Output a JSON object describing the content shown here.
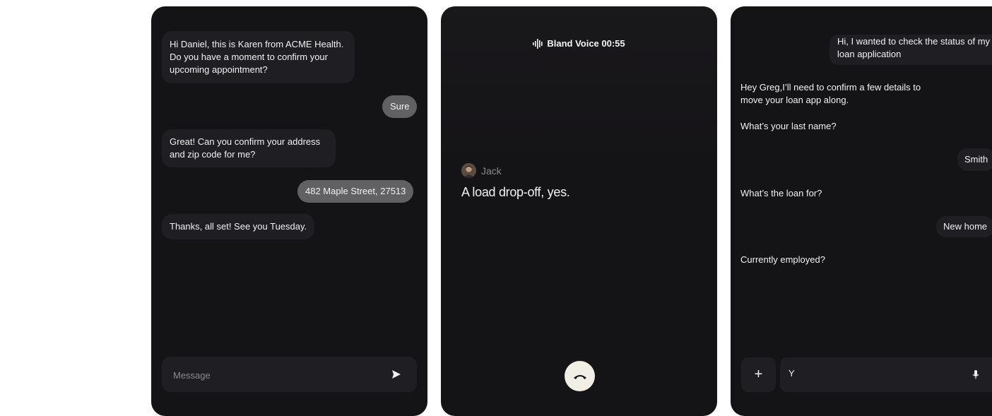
{
  "sms_chat": {
    "messages": [
      {
        "from": "agent",
        "text": "Hi Daniel, this is Karen from ACME Health. Do you have a moment to confirm your upcoming appointment?"
      },
      {
        "from": "user",
        "text": "Sure"
      },
      {
        "from": "agent",
        "text": "Great! Can you confirm your address and zip code for me?"
      },
      {
        "from": "user",
        "text": "482 Maple Street, 27513"
      },
      {
        "from": "agent",
        "text": "Thanks, all set! See you Tuesday."
      }
    ],
    "input_placeholder": "Message",
    "send_icon": "send-icon"
  },
  "voice_call": {
    "header_label": "Bland Voice 00:55",
    "speaker_name": "Jack",
    "transcript": "A load drop-off, yes.",
    "hangup_icon": "phone-hangup-icon"
  },
  "loan_chat": {
    "messages": [
      {
        "from": "user",
        "text": "Hi, I wanted to check the status of my loan application"
      },
      {
        "from": "agent",
        "text": "Hey Greg,I’ll need to confirm a few details to move your loan app along."
      },
      {
        "from": "agent",
        "text": "What’s your last name?"
      },
      {
        "from": "user",
        "text": "Smith"
      },
      {
        "from": "agent",
        "text": "What’s the loan for?"
      },
      {
        "from": "user",
        "text": "New home"
      },
      {
        "from": "agent",
        "text": "Currently employed?"
      }
    ],
    "plus_label": "+",
    "input_value": "Y",
    "mic_icon": "microphone-icon"
  },
  "colors": {
    "panel_bg": "#141316",
    "agent_bubble": "#1f1e22",
    "user_bubble": "#616063",
    "hangup_button": "#f1eee5"
  }
}
